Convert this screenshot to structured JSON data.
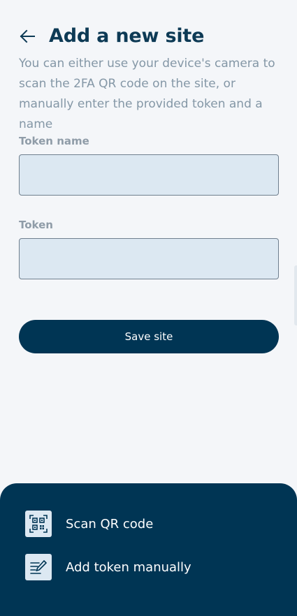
{
  "header": {
    "back_icon": "arrow-left-icon",
    "title": "Add a new site"
  },
  "intro": "You can either use your device's camera to scan the 2FA QR code on the site, or manually enter the provided token and a name",
  "form": {
    "token_name_label": "Token name",
    "token_name_value": "",
    "token_label": "Token",
    "token_value": "",
    "save_label": "Save site"
  },
  "sheet": {
    "items": [
      {
        "label": "Scan QR code",
        "icon": "qr-code-icon"
      },
      {
        "label": "Add token manually",
        "icon": "edit-note-icon"
      }
    ]
  },
  "colors": {
    "primary": "#003554",
    "title": "#0d3a55",
    "input_bg": "#dce8f2",
    "background": "#f4f6f9",
    "muted_text": "#8497a6"
  }
}
